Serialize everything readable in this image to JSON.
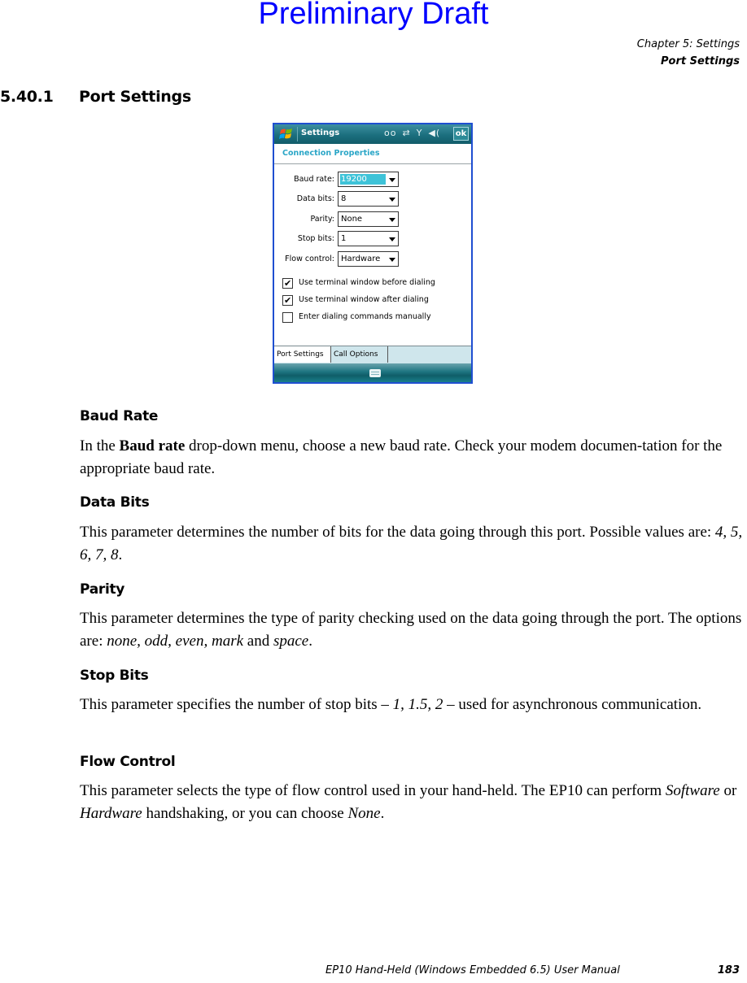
{
  "watermark": "Preliminary Draft",
  "running_header": {
    "chapter": "Chapter 5:  Settings",
    "section": "Port Settings"
  },
  "section": {
    "number": "5.40.1",
    "title": "Port Settings"
  },
  "screenshot": {
    "titlebar": {
      "title": "Settings",
      "status_icons": [
        "voicemail-icon",
        "sync-arrows-icon",
        "signal-antenna-icon",
        "speaker-icon"
      ],
      "ok_label": "ok"
    },
    "header": "Connection Properties",
    "fields": [
      {
        "label": "Baud rate:",
        "value": "19200",
        "selected": true
      },
      {
        "label": "Data bits:",
        "value": "8"
      },
      {
        "label": "Parity:",
        "value": "None"
      },
      {
        "label": "Stop bits:",
        "value": "1"
      },
      {
        "label": "Flow control:",
        "value": "Hardware"
      }
    ],
    "checkboxes": [
      {
        "label": "Use terminal window before dialing",
        "checked": true
      },
      {
        "label": "Use terminal window after dialing",
        "checked": true
      },
      {
        "label": "Enter dialing commands manually",
        "checked": false
      }
    ],
    "tabs": [
      {
        "label": "Port Settings",
        "active": true
      },
      {
        "label": "Call Options",
        "active": false
      }
    ],
    "check_glyph": "✔",
    "colors": {
      "titlebar": "#1b6f7e",
      "header_text": "#2aa6c7",
      "selection": "#3ec3d8",
      "frame": "#1f4fd1"
    }
  },
  "topics": [
    {
      "heading": "Baud Rate",
      "parts": [
        "In the ",
        "Baud rate",
        " drop-down menu, choose a new baud rate. Check your modem documen-tation for the appropriate baud rate."
      ]
    },
    {
      "heading": "Data Bits",
      "parts": [
        "This parameter determines the number of bits for the data going through this port. Possible values are: ",
        "4, 5, 6, 7, 8",
        "."
      ]
    },
    {
      "heading": "Parity",
      "parts": [
        "This parameter determines the type of parity checking used on the data going through the port. The options are: ",
        "none, odd, even, mark",
        " and ",
        "space",
        "."
      ]
    },
    {
      "heading": "Stop Bits",
      "parts": [
        "This parameter specifies the number of stop bits – ",
        "1, 1.5, 2",
        " – used for asynchronous communication."
      ]
    },
    {
      "heading": "Flow Control",
      "parts": [
        "This parameter selects the type of flow control used in your hand-held. The EP10 can perform ",
        "Software",
        " or ",
        "Hardware",
        " handshaking, or you can choose ",
        "None",
        "."
      ]
    }
  ],
  "footer": {
    "manual_title": "EP10 Hand-Held (Windows Embedded 6.5) User Manual",
    "page_number": "183"
  }
}
